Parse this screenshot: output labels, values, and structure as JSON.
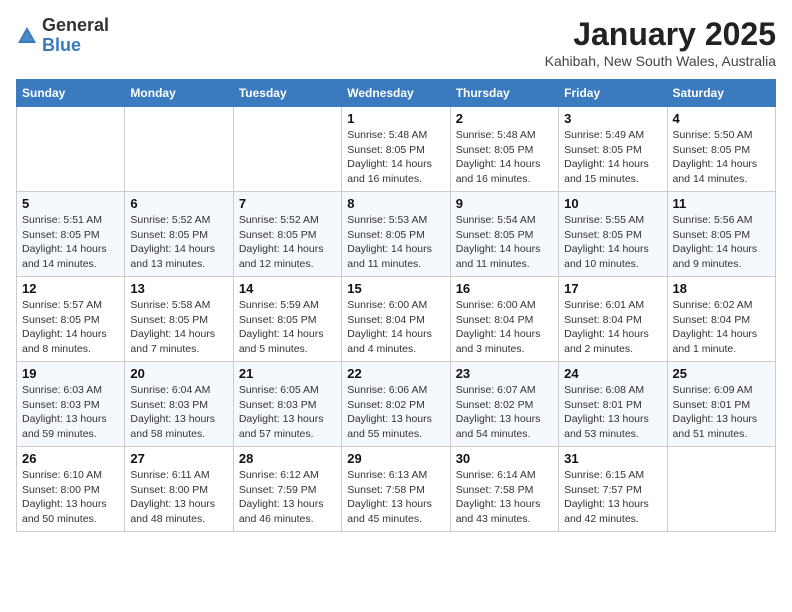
{
  "header": {
    "logo_general": "General",
    "logo_blue": "Blue",
    "month_year": "January 2025",
    "location": "Kahibah, New South Wales, Australia"
  },
  "weekdays": [
    "Sunday",
    "Monday",
    "Tuesday",
    "Wednesday",
    "Thursday",
    "Friday",
    "Saturday"
  ],
  "weeks": [
    [
      {
        "day": "",
        "info": ""
      },
      {
        "day": "",
        "info": ""
      },
      {
        "day": "",
        "info": ""
      },
      {
        "day": "1",
        "info": "Sunrise: 5:48 AM\nSunset: 8:05 PM\nDaylight: 14 hours\nand 16 minutes."
      },
      {
        "day": "2",
        "info": "Sunrise: 5:48 AM\nSunset: 8:05 PM\nDaylight: 14 hours\nand 16 minutes."
      },
      {
        "day": "3",
        "info": "Sunrise: 5:49 AM\nSunset: 8:05 PM\nDaylight: 14 hours\nand 15 minutes."
      },
      {
        "day": "4",
        "info": "Sunrise: 5:50 AM\nSunset: 8:05 PM\nDaylight: 14 hours\nand 14 minutes."
      }
    ],
    [
      {
        "day": "5",
        "info": "Sunrise: 5:51 AM\nSunset: 8:05 PM\nDaylight: 14 hours\nand 14 minutes."
      },
      {
        "day": "6",
        "info": "Sunrise: 5:52 AM\nSunset: 8:05 PM\nDaylight: 14 hours\nand 13 minutes."
      },
      {
        "day": "7",
        "info": "Sunrise: 5:52 AM\nSunset: 8:05 PM\nDaylight: 14 hours\nand 12 minutes."
      },
      {
        "day": "8",
        "info": "Sunrise: 5:53 AM\nSunset: 8:05 PM\nDaylight: 14 hours\nand 11 minutes."
      },
      {
        "day": "9",
        "info": "Sunrise: 5:54 AM\nSunset: 8:05 PM\nDaylight: 14 hours\nand 11 minutes."
      },
      {
        "day": "10",
        "info": "Sunrise: 5:55 AM\nSunset: 8:05 PM\nDaylight: 14 hours\nand 10 minutes."
      },
      {
        "day": "11",
        "info": "Sunrise: 5:56 AM\nSunset: 8:05 PM\nDaylight: 14 hours\nand 9 minutes."
      }
    ],
    [
      {
        "day": "12",
        "info": "Sunrise: 5:57 AM\nSunset: 8:05 PM\nDaylight: 14 hours\nand 8 minutes."
      },
      {
        "day": "13",
        "info": "Sunrise: 5:58 AM\nSunset: 8:05 PM\nDaylight: 14 hours\nand 7 minutes."
      },
      {
        "day": "14",
        "info": "Sunrise: 5:59 AM\nSunset: 8:05 PM\nDaylight: 14 hours\nand 5 minutes."
      },
      {
        "day": "15",
        "info": "Sunrise: 6:00 AM\nSunset: 8:04 PM\nDaylight: 14 hours\nand 4 minutes."
      },
      {
        "day": "16",
        "info": "Sunrise: 6:00 AM\nSunset: 8:04 PM\nDaylight: 14 hours\nand 3 minutes."
      },
      {
        "day": "17",
        "info": "Sunrise: 6:01 AM\nSunset: 8:04 PM\nDaylight: 14 hours\nand 2 minutes."
      },
      {
        "day": "18",
        "info": "Sunrise: 6:02 AM\nSunset: 8:04 PM\nDaylight: 14 hours\nand 1 minute."
      }
    ],
    [
      {
        "day": "19",
        "info": "Sunrise: 6:03 AM\nSunset: 8:03 PM\nDaylight: 13 hours\nand 59 minutes."
      },
      {
        "day": "20",
        "info": "Sunrise: 6:04 AM\nSunset: 8:03 PM\nDaylight: 13 hours\nand 58 minutes."
      },
      {
        "day": "21",
        "info": "Sunrise: 6:05 AM\nSunset: 8:03 PM\nDaylight: 13 hours\nand 57 minutes."
      },
      {
        "day": "22",
        "info": "Sunrise: 6:06 AM\nSunset: 8:02 PM\nDaylight: 13 hours\nand 55 minutes."
      },
      {
        "day": "23",
        "info": "Sunrise: 6:07 AM\nSunset: 8:02 PM\nDaylight: 13 hours\nand 54 minutes."
      },
      {
        "day": "24",
        "info": "Sunrise: 6:08 AM\nSunset: 8:01 PM\nDaylight: 13 hours\nand 53 minutes."
      },
      {
        "day": "25",
        "info": "Sunrise: 6:09 AM\nSunset: 8:01 PM\nDaylight: 13 hours\nand 51 minutes."
      }
    ],
    [
      {
        "day": "26",
        "info": "Sunrise: 6:10 AM\nSunset: 8:00 PM\nDaylight: 13 hours\nand 50 minutes."
      },
      {
        "day": "27",
        "info": "Sunrise: 6:11 AM\nSunset: 8:00 PM\nDaylight: 13 hours\nand 48 minutes."
      },
      {
        "day": "28",
        "info": "Sunrise: 6:12 AM\nSunset: 7:59 PM\nDaylight: 13 hours\nand 46 minutes."
      },
      {
        "day": "29",
        "info": "Sunrise: 6:13 AM\nSunset: 7:58 PM\nDaylight: 13 hours\nand 45 minutes."
      },
      {
        "day": "30",
        "info": "Sunrise: 6:14 AM\nSunset: 7:58 PM\nDaylight: 13 hours\nand 43 minutes."
      },
      {
        "day": "31",
        "info": "Sunrise: 6:15 AM\nSunset: 7:57 PM\nDaylight: 13 hours\nand 42 minutes."
      },
      {
        "day": "",
        "info": ""
      }
    ]
  ]
}
